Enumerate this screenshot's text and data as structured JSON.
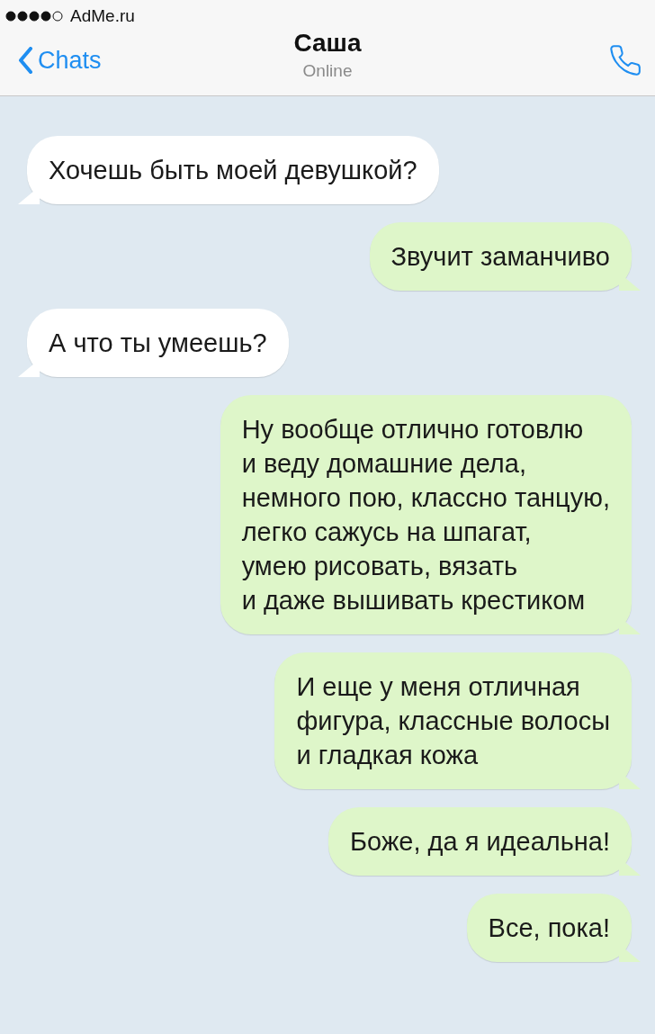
{
  "status_bar": {
    "carrier": "AdMe.ru"
  },
  "header": {
    "back_label": "Chats",
    "title": "Саша",
    "subtitle": "Online"
  },
  "messages": [
    {
      "text": "Хочешь быть моей девушкой?",
      "outgoing": false
    },
    {
      "text": "Звучит заманчиво",
      "outgoing": true
    },
    {
      "text": "А что ты умеешь?",
      "outgoing": false
    },
    {
      "text": "Ну вообще отлично готовлю\nи веду домашние дела,\nнемного пою, классно танцую,\nлегко сажусь на шпагат,\nумею рисовать, вязать\nи даже вышивать крестиком",
      "outgoing": true
    },
    {
      "text": "И еще у меня отличная\nфигура, классные волосы\nи гладкая кожа",
      "outgoing": true
    },
    {
      "text": "Боже, да я идеальна!",
      "outgoing": true
    },
    {
      "text": "Все, пока!",
      "outgoing": true
    }
  ]
}
